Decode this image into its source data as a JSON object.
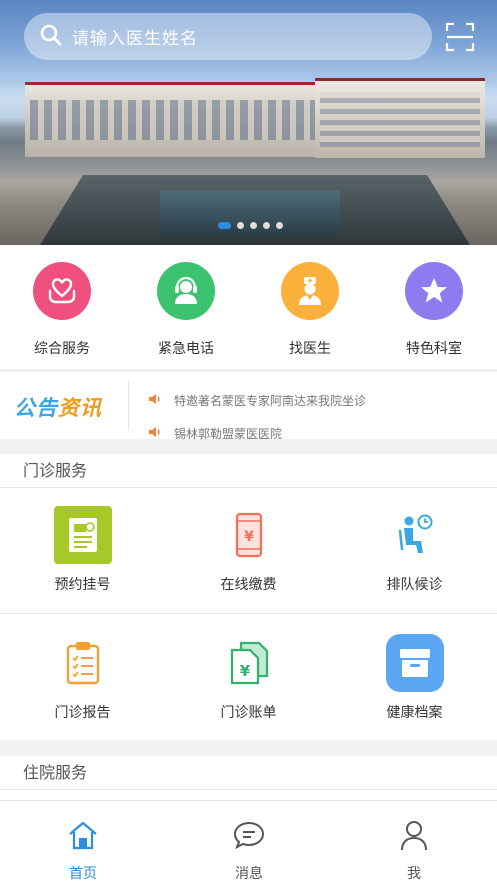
{
  "search": {
    "placeholder": "请输入医生姓名"
  },
  "banner": {
    "slides": 5,
    "active_slide": 1
  },
  "quick_entries": [
    {
      "label": "综合服务",
      "icon": "heart-hands-icon",
      "color": "#f0507f"
    },
    {
      "label": "紧急电话",
      "icon": "headset-agent-icon",
      "color": "#3cc36f"
    },
    {
      "label": "找医生",
      "icon": "doctor-icon",
      "color": "#fbb03b"
    },
    {
      "label": "特色科室",
      "icon": "star-icon",
      "color": "#8c7cf0"
    }
  ],
  "notices": {
    "logo": {
      "part1": "公告",
      "part2": "资讯"
    },
    "items": [
      "特邀著名蒙医专家阿南达来我院坐诊",
      "锡林郭勒盟蒙医医院"
    ]
  },
  "outpatient": {
    "title": "门诊服务",
    "items": [
      {
        "label": "预约挂号",
        "icon": "appointment-doc-icon"
      },
      {
        "label": "在线缴费",
        "icon": "mobile-payment-icon"
      },
      {
        "label": "排队候诊",
        "icon": "queue-waiting-icon"
      },
      {
        "label": "门诊报告",
        "icon": "clipboard-report-icon"
      },
      {
        "label": "门诊账单",
        "icon": "bill-icon"
      },
      {
        "label": "健康档案",
        "icon": "archive-box-icon"
      }
    ]
  },
  "inpatient": {
    "title": "住院服务"
  },
  "tabbar": [
    {
      "label": "首页",
      "icon": "home-icon",
      "active": true
    },
    {
      "label": "消息",
      "icon": "message-icon",
      "active": false
    },
    {
      "label": "我",
      "icon": "user-icon",
      "active": false
    }
  ],
  "colors": {
    "accent": "#2b8de0",
    "orange": "#f39a1a"
  }
}
